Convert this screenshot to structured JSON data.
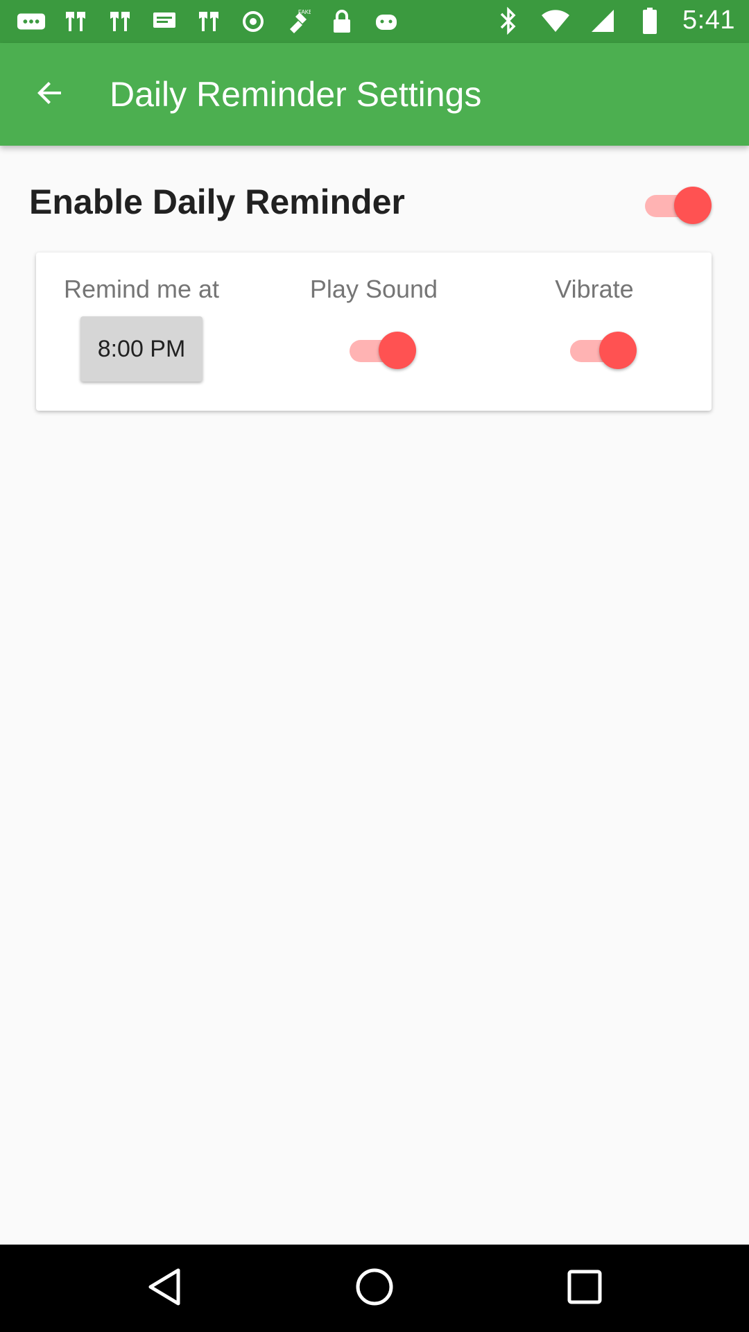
{
  "status_bar": {
    "time": "5:41",
    "left_icons": [
      "more-icon",
      "notification-icon",
      "notification-icon",
      "message-icon",
      "notification-icon",
      "sync-icon",
      "fake-gps-icon",
      "lock-icon",
      "android-icon"
    ],
    "right_icons": [
      "bluetooth-icon",
      "wifi-icon",
      "signal-icon",
      "battery-icon"
    ]
  },
  "app_bar": {
    "title": "Daily Reminder Settings",
    "back_icon": "arrow-back-icon"
  },
  "enable_reminder": {
    "label": "Enable Daily Reminder",
    "enabled": true
  },
  "card": {
    "remind_label": "Remind me at",
    "time_value": "8:00 PM",
    "sound_label": "Play Sound",
    "sound_enabled": true,
    "vibrate_label": "Vibrate",
    "vibrate_enabled": true
  },
  "colors": {
    "app_bar": "#4caf50",
    "status_bar": "#3b9a3f",
    "switch_thumb": "#ff5252",
    "switch_track": "#ffb3b3"
  },
  "nav_bar": {
    "buttons": [
      "back-triangle-icon",
      "home-circle-icon",
      "recents-square-icon"
    ]
  }
}
